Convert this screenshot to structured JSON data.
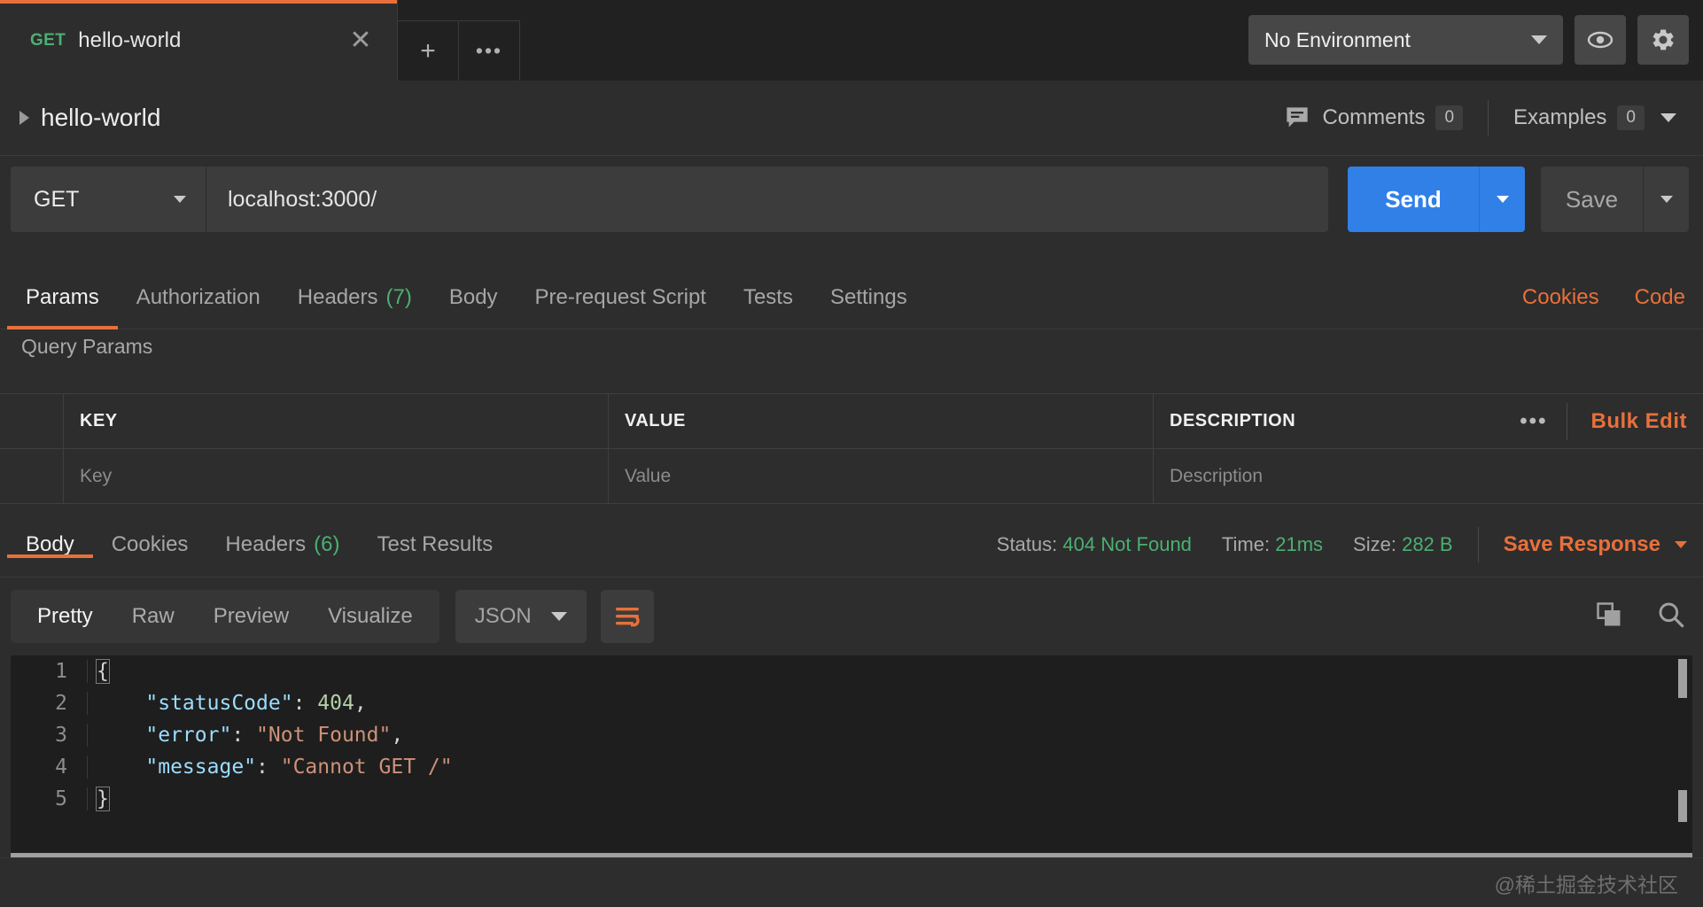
{
  "tab": {
    "method": "GET",
    "title": "hello-world",
    "close_icon": "close-icon",
    "new_tab_icon": "+",
    "more_icon": "•••"
  },
  "environment": {
    "selected": "No Environment",
    "eye_icon": "eye-icon",
    "gear_icon": "gear-icon"
  },
  "breadcrumb": {
    "title": "hello-world",
    "comments_label": "Comments",
    "comments_count": "0",
    "examples_label": "Examples",
    "examples_count": "0",
    "comment_icon": "comment-icon"
  },
  "request": {
    "method": "GET",
    "url": "localhost:3000/",
    "send_label": "Send",
    "save_label": "Save"
  },
  "request_tabs": [
    {
      "label": "Params",
      "count": "",
      "active": true
    },
    {
      "label": "Authorization",
      "count": "",
      "active": false
    },
    {
      "label": "Headers",
      "count": "(7)",
      "active": false
    },
    {
      "label": "Body",
      "count": "",
      "active": false
    },
    {
      "label": "Pre-request Script",
      "count": "",
      "active": false
    },
    {
      "label": "Tests",
      "count": "",
      "active": false
    },
    {
      "label": "Settings",
      "count": "",
      "active": false
    }
  ],
  "request_tabs_right": {
    "cookies": "Cookies",
    "code": "Code"
  },
  "query_params": {
    "section_title": "Query Params",
    "headers": {
      "key": "KEY",
      "value": "VALUE",
      "description": "DESCRIPTION"
    },
    "row_placeholders": {
      "key": "Key",
      "value": "Value",
      "description": "Description"
    },
    "more_icon": "•••",
    "bulk_edit": "Bulk Edit"
  },
  "response_tabs": [
    {
      "label": "Body",
      "count": "",
      "active": true
    },
    {
      "label": "Cookies",
      "count": "",
      "active": false
    },
    {
      "label": "Headers",
      "count": "(6)",
      "active": false
    },
    {
      "label": "Test Results",
      "count": "",
      "active": false
    }
  ],
  "response_meta": {
    "status_label": "Status:",
    "status_value": "404 Not Found",
    "time_label": "Time:",
    "time_value": "21ms",
    "size_label": "Size:",
    "size_value": "282 B",
    "save_response": "Save Response"
  },
  "body_toolbar": {
    "views": [
      {
        "label": "Pretty",
        "active": true
      },
      {
        "label": "Raw",
        "active": false
      },
      {
        "label": "Preview",
        "active": false
      },
      {
        "label": "Visualize",
        "active": false
      }
    ],
    "format": "JSON",
    "wrap_icon": "wrap-lines-icon",
    "copy_icon": "copy-icon",
    "search_icon": "search-icon"
  },
  "response_body": {
    "language": "json",
    "lines": [
      {
        "n": "1",
        "tokens": [
          {
            "t": "{",
            "c": "k-pun brace-hl"
          }
        ]
      },
      {
        "n": "2",
        "tokens": [
          {
            "t": "    ",
            "c": "k-pun"
          },
          {
            "t": "\"statusCode\"",
            "c": "k-key"
          },
          {
            "t": ": ",
            "c": "k-pun"
          },
          {
            "t": "404",
            "c": "k-num"
          },
          {
            "t": ",",
            "c": "k-pun"
          }
        ]
      },
      {
        "n": "3",
        "tokens": [
          {
            "t": "    ",
            "c": "k-pun"
          },
          {
            "t": "\"error\"",
            "c": "k-key"
          },
          {
            "t": ": ",
            "c": "k-pun"
          },
          {
            "t": "\"Not Found\"",
            "c": "k-str"
          },
          {
            "t": ",",
            "c": "k-pun"
          }
        ]
      },
      {
        "n": "4",
        "tokens": [
          {
            "t": "    ",
            "c": "k-pun"
          },
          {
            "t": "\"message\"",
            "c": "k-key"
          },
          {
            "t": ": ",
            "c": "k-pun"
          },
          {
            "t": "\"Cannot GET /\"",
            "c": "k-str"
          }
        ]
      },
      {
        "n": "5",
        "tokens": [
          {
            "t": "}",
            "c": "k-pun brace-hl"
          }
        ]
      }
    ]
  },
  "footer": {
    "watermark": "@稀土掘金技术社区"
  },
  "colors": {
    "accent_orange": "#e8703a",
    "send_blue": "#3080e8",
    "status_green": "#4caf72",
    "bg": "#2d2d2d",
    "tabstrip_bg": "#212121",
    "code_bg": "#1e1e1e"
  }
}
